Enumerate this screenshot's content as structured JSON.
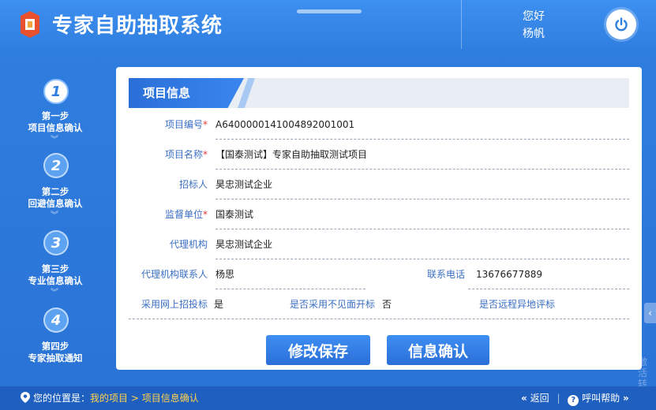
{
  "header": {
    "app_title": "专家自助抽取系统",
    "greeting": "您好",
    "user_name": "杨帆",
    "power_icon": "power-icon",
    "logo_icon": "logo-icon"
  },
  "steps": [
    {
      "number": "1",
      "line1": "第一步",
      "line2": "项目信息确认",
      "active": true
    },
    {
      "number": "2",
      "line1": "第二步",
      "line2": "回避信息确认",
      "active": false
    },
    {
      "number": "3",
      "line1": "第三步",
      "line2": "专业信息确认",
      "active": false
    },
    {
      "number": "4",
      "line1": "第四步",
      "line2": "专家抽取通知",
      "active": false
    }
  ],
  "panel": {
    "title": "项目信息",
    "fields": {
      "project_no_label": "项目编号",
      "project_no_value": "A640000014100489200100​1",
      "project_name_label": "项目名称",
      "project_name_value": "【国泰测试】专家自助抽取测试项目",
      "tenderer_label": "招标人",
      "tenderer_value": "昊忠测试企业",
      "supervisor_label": "监督单位",
      "supervisor_value": "国泰测试",
      "agency_label": "代理机构",
      "agency_value": "昊忠测试企业",
      "agency_contact_label": "代理机构联系人",
      "agency_contact_value": "杨思",
      "phone_label": "联系电话",
      "phone_value": "13676677889",
      "online_label": "采用网上招投标",
      "online_value": "是",
      "no_meet_label": "是否采用不见面开标",
      "no_meet_value": "否",
      "remote_label": "是否远程异地评标",
      "remote_value": ""
    },
    "required_mark": "*",
    "buttons": {
      "save": "修改保存",
      "confirm": "信息确认"
    }
  },
  "footer": {
    "location_prefix": "您的位置是：",
    "crumb_home": "我的项目",
    "crumb_sep": " > ",
    "crumb_current": "项目信息确认",
    "back_label": "返回",
    "help_label": "呼叫帮助"
  },
  "watermark": {
    "line1": "激活",
    "line2": "转到"
  }
}
